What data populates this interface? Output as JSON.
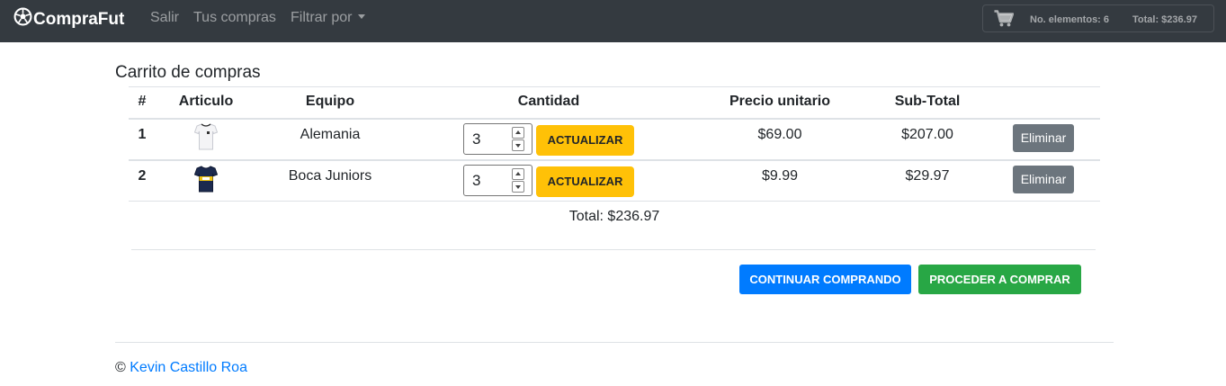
{
  "navbar": {
    "brand": "CompraFut",
    "links": [
      "Salir",
      "Tus compras",
      "Filtrar por"
    ],
    "cart_count": "No. elementos: 6",
    "cart_total": "Total: $236.97",
    "bg_color": "#343a40"
  },
  "cart": {
    "title": "Carrito de compras",
    "headers": [
      "#",
      "Articulo",
      "Equipo",
      "Cantidad",
      "Precio unitario",
      "Sub-Total"
    ],
    "rows": [
      {
        "index": "1",
        "item_icon": "white-jersey-icon",
        "team": "Alemania",
        "quantity": "3",
        "update_label": "ACTUALIZAR",
        "unit_price": "$69.00",
        "subtotal": "$207.00",
        "remove_label": "Eliminar"
      },
      {
        "index": "2",
        "item_icon": "navy-gold-jersey-icon",
        "team": "Boca Juniors",
        "quantity": "3",
        "update_label": "ACTUALIZAR",
        "unit_price": "$9.99",
        "subtotal": "$29.97",
        "remove_label": "Eliminar"
      }
    ],
    "total": "Total: $236.97"
  },
  "actions": {
    "continue_label": "CONTINUAR COMPRANDO",
    "checkout_label": "PROCEDER A COMPRAR"
  },
  "footer": {
    "copyright": "©",
    "author": "Kevin Castillo Roa"
  },
  "colors": {
    "primary": "#007bff",
    "success": "#28a745",
    "warning": "#ffc107",
    "secondary": "#6c757d"
  }
}
